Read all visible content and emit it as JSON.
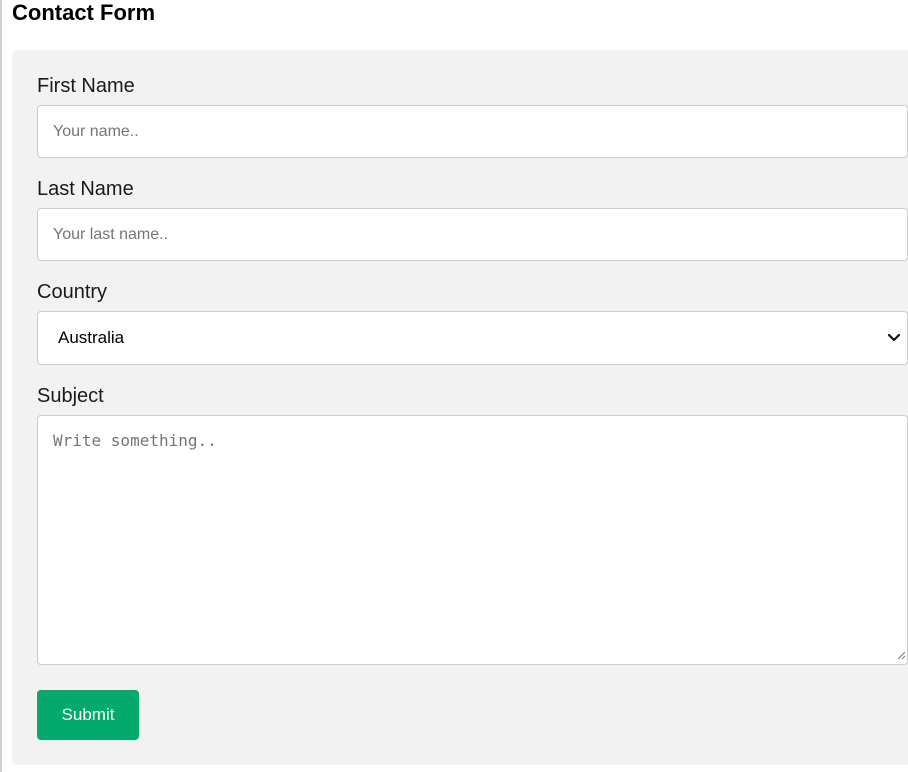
{
  "page": {
    "title": "Contact Form"
  },
  "form": {
    "first_name": {
      "label": "First Name",
      "placeholder": "Your name..",
      "value": ""
    },
    "last_name": {
      "label": "Last Name",
      "placeholder": "Your last name..",
      "value": ""
    },
    "country": {
      "label": "Country",
      "selected": "Australia"
    },
    "subject": {
      "label": "Subject",
      "placeholder": "Write something..",
      "value": ""
    },
    "submit_label": "Submit"
  },
  "colors": {
    "panel_background": "#f2f2f2",
    "submit_background": "#04aa6d",
    "input_border": "#cccccc"
  },
  "icons": {
    "select_arrow": "chevron-down-icon",
    "textarea_resize": "resize-grip-icon"
  }
}
